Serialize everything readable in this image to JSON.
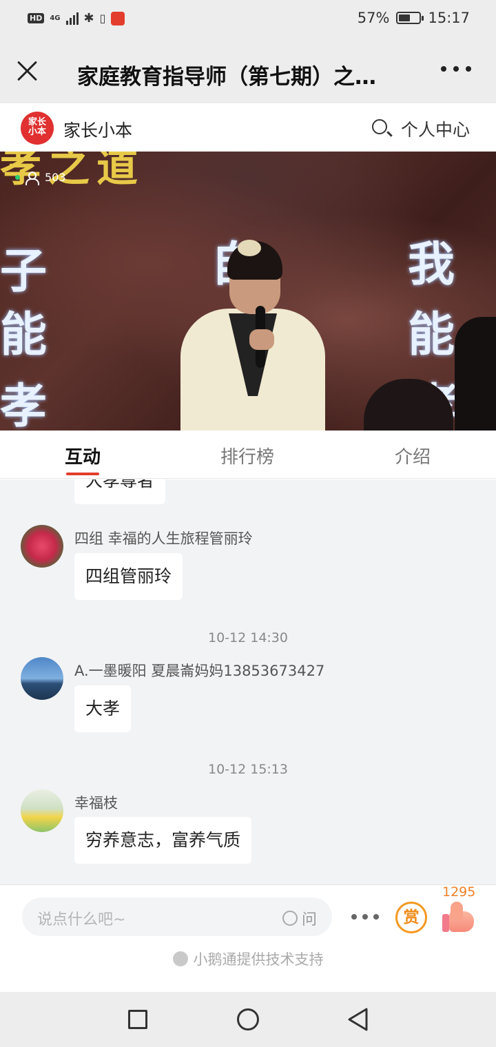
{
  "status_bar": {
    "network": "HD",
    "network_gen": "4G",
    "battery_percent": "57%",
    "battery_level": 0.57,
    "time": "15:17"
  },
  "title_bar": {
    "title": "家庭教育指导师（第七期）之…",
    "close_icon": "close-icon",
    "more_icon": "more-icon"
  },
  "app_header": {
    "logo_text": "家长小本",
    "app_name": "家长小本",
    "search_icon": "search-icon",
    "personal_center": "个人中心"
  },
  "video": {
    "viewer_count": "503",
    "live": true
  },
  "tabs": [
    {
      "label": "互动",
      "active": true
    },
    {
      "label": "排行榜",
      "active": false
    },
    {
      "label": "介绍",
      "active": false
    }
  ],
  "chat": {
    "partial_message": "大孝尊者",
    "messages": [
      {
        "nickname": "四组 幸福的人生旅程管丽玲",
        "text": "四组管丽玲"
      },
      {
        "time": "10-12 14:30",
        "nickname": "A.一墨暖阳 夏晨崙妈妈13853673427",
        "text": "大孝"
      },
      {
        "time": "10-12 15:13",
        "nickname": "幸福枝",
        "text": "穷养意志，富养气质"
      }
    ]
  },
  "bottom": {
    "input_placeholder": "说点什么吧~",
    "ask_label": "问",
    "reward_label": "赏",
    "like_count": "1295",
    "support_text": "小鹅通提供技术支持"
  },
  "colors": {
    "accent": "#e23d2d",
    "reward": "#f59a23",
    "like": "#f07e24"
  }
}
